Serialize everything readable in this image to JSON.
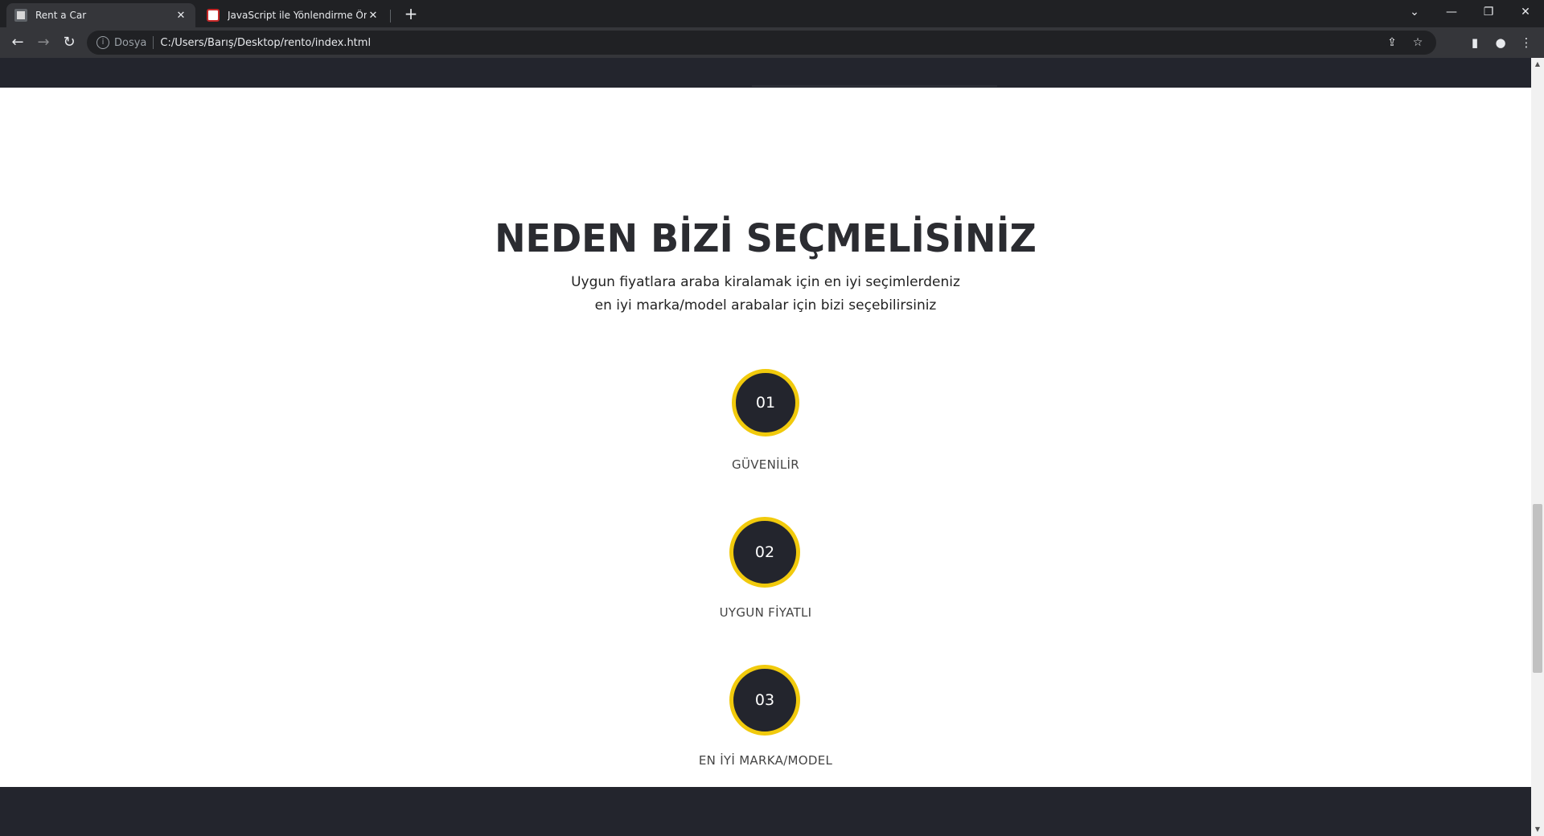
{
  "browser": {
    "tabs": [
      {
        "title": "Rent a Car",
        "icon": "rent-favicon",
        "active": true
      },
      {
        "title": "JavaScript ile Yönlendirme Örneğ",
        "icon": "js-favicon",
        "active": false
      }
    ],
    "tab_close_glyph": "✕",
    "new_tab_glyph": "+",
    "window_controls": {
      "tab_search": "⌄",
      "minimize": "—",
      "restore": "❐",
      "close": "✕"
    },
    "nav": {
      "back": "←",
      "forward": "→",
      "reload": "↻"
    },
    "address": {
      "info_glyph": "i",
      "scheme_label": "Dosya",
      "url": "C:/Users/Barış/Desktop/rento/index.html"
    },
    "toolbar_icons": {
      "share": "⇪",
      "bookmark": "☆",
      "side_panel": "▮",
      "profile": "●",
      "menu": "⋮"
    }
  },
  "page": {
    "section_title": "NEDEN BİZİ SEÇMELİSİNİZ",
    "subtitle_line1": "Uygun fiyatlara araba kiralamak için en iyi seçimlerdeniz",
    "subtitle_line2": "en iyi marka/model arabalar için bizi seçebilirsiniz",
    "features": [
      {
        "number": "01",
        "label": "GÜVENİLİR"
      },
      {
        "number": "02",
        "label": "UYGUN FİYATLI"
      },
      {
        "number": "03",
        "label": "EN İYİ MARKA/MODEL"
      }
    ]
  },
  "colors": {
    "dark": "#23252d",
    "accent_yellow": "#f1ca0c",
    "chrome_bg": "#202124",
    "chrome_toolbar": "#35363a"
  },
  "scrollbar": {
    "up": "▲",
    "down": "▼"
  }
}
